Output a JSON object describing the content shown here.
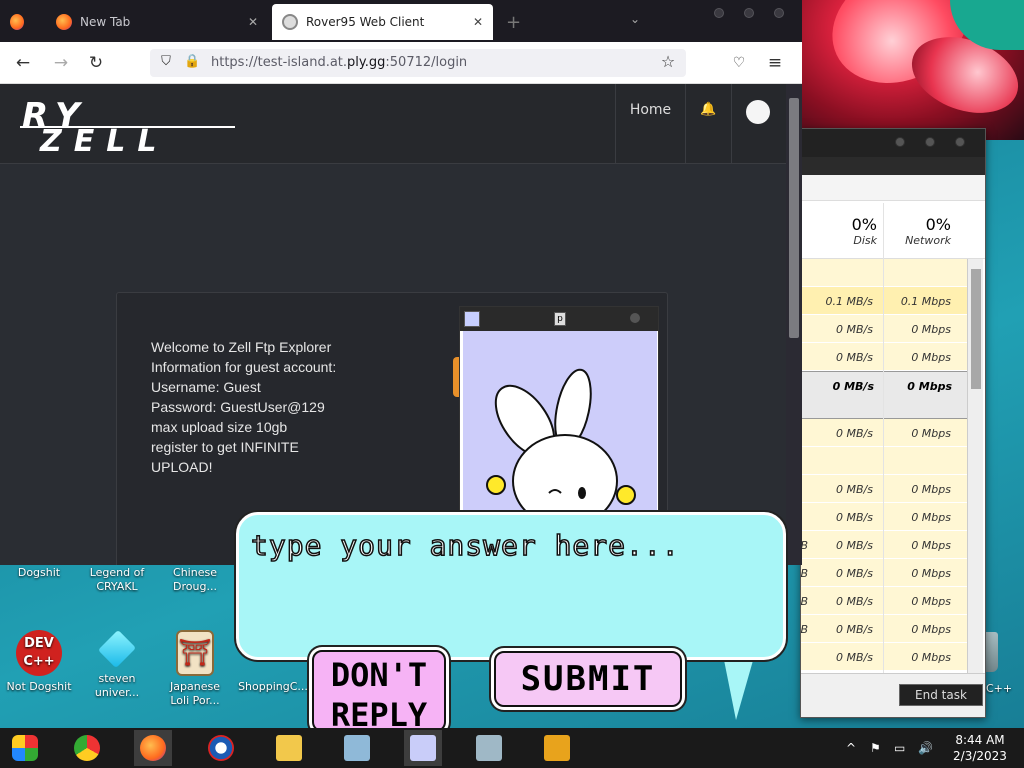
{
  "browser": {
    "tabs": [
      {
        "label": ""
      },
      {
        "label": "New Tab"
      },
      {
        "label": "Rover95 Web Client"
      }
    ],
    "new_tab_symbol": "+",
    "url_prefix": "https://test-island.at.",
    "url_domain": "ply.gg",
    "url_suffix": ":50712/login",
    "back_icon": "←",
    "forward_icon": "→",
    "reload_icon": "↻",
    "menu_icon": "≡"
  },
  "site": {
    "logo_top": "RY",
    "logo_bottom": "ZELL",
    "nav_home": "Home",
    "welcome_lines": [
      "Welcome to Zell Ftp Explorer",
      "Information for guest account:",
      "Username: Guest",
      "Password: GuestUser@129",
      "max upload size 10gb",
      "register to get INFINITE",
      "UPLOAD!"
    ]
  },
  "popup": {
    "answer_placeholder": "type your answer here...",
    "dont_reply_line1": "DON'T",
    "dont_reply_line2": "REPLY",
    "submit_label": "SUBMIT",
    "small_icon_label": "p"
  },
  "taskmgr": {
    "disk_pct": "0%",
    "network_pct": "0%",
    "disk_label": "Disk",
    "network_label": "Network",
    "rows": [
      {
        "disk": "",
        "net": "",
        "style": "plain"
      },
      {
        "disk": "0.1 MB/s",
        "net": "0.1 Mbps",
        "style": "bar"
      },
      {
        "disk": "0 MB/s",
        "net": "0 Mbps",
        "style": "plain"
      },
      {
        "disk": "0 MB/s",
        "net": "0 Mbps",
        "style": "plain"
      },
      {
        "disk": "0 MB/s",
        "net": "0 Mbps",
        "style": "sel"
      },
      {
        "disk": "0 MB/s",
        "net": "0 Mbps",
        "style": "plain"
      },
      {
        "disk": "",
        "net": "",
        "style": "plain"
      },
      {
        "disk": "0 MB/s",
        "net": "0 Mbps",
        "style": "plain"
      },
      {
        "disk": "0 MB/s",
        "net": "0 Mbps",
        "style": "plain"
      },
      {
        "disk": "MB",
        "net": "0 MB/s",
        "net2": "0 Mbps",
        "style": "plain"
      }
    ],
    "rows_extra": [
      {
        "a": "MB",
        "b": "0 MB/s",
        "c": "0 Mbps"
      },
      {
        "a": "MB",
        "b": "0 MB/s",
        "c": "0 Mbps"
      },
      {
        "a": "MB",
        "b": "0 MB/s",
        "c": "0 Mbps"
      },
      {
        "a": "MB",
        "b": "0 MB/s",
        "c": "0 Mbps"
      },
      {
        "a": "",
        "b": "0 MB/s",
        "c": "0 Mbps"
      }
    ],
    "end_task": "End task"
  },
  "desktop": {
    "icons": [
      {
        "label1": "Dogshit",
        "label2": ""
      },
      {
        "label1": "Legend of",
        "label2": "CRYAKL"
      },
      {
        "label1": "Chinese",
        "label2": "Droug..."
      },
      {
        "label1": "Not Dogshit",
        "label2": ""
      },
      {
        "label1": "steven",
        "label2": "univer..."
      },
      {
        "label1": "Japanese",
        "label2": "Loli Por..."
      },
      {
        "label1": "ShoppingC...",
        "label2": ""
      }
    ],
    "dev_cpp_text1": "DEV",
    "dev_cpp_text2": "C++",
    "cpp_side_label": "C++"
  },
  "taskbar": {
    "time": "8:44 AM",
    "date": "2/3/2023",
    "tray_chevron": "^"
  }
}
